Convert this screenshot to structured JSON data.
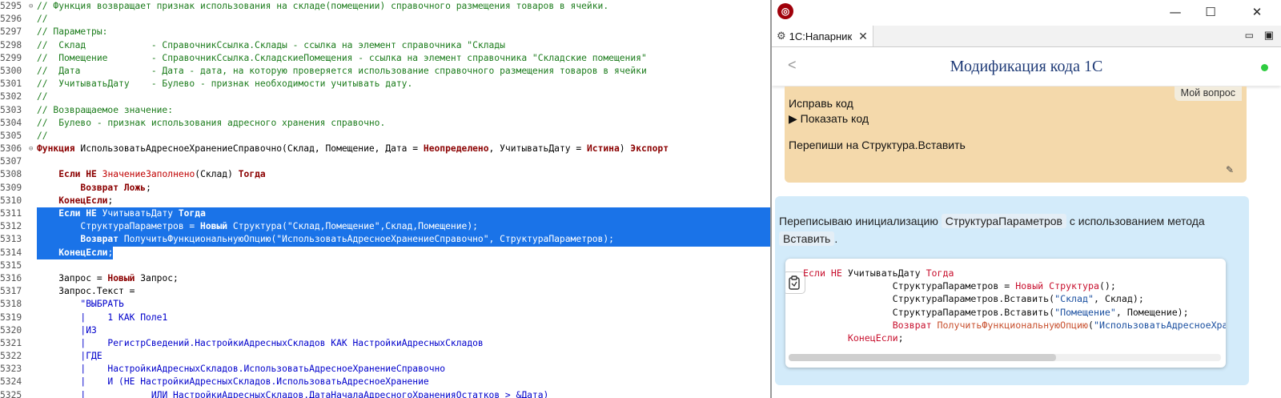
{
  "editor": {
    "lines": [
      {
        "n": "5295",
        "fold": "⊖",
        "segs": [
          [
            "t-cm",
            "// Функция возвращает признак использования на складе(помещении) справочного размещения товаров в ячейки."
          ]
        ]
      },
      {
        "n": "5296",
        "segs": [
          [
            "t-cm",
            "//"
          ]
        ]
      },
      {
        "n": "5297",
        "segs": [
          [
            "t-cm",
            "// Параметры:"
          ]
        ]
      },
      {
        "n": "5298",
        "segs": [
          [
            "t-cm",
            "//  Склад            - СправочникСсылка.Склады - ссылка на элемент справочника \"Склады"
          ]
        ]
      },
      {
        "n": "5299",
        "segs": [
          [
            "t-cm",
            "//  Помещение        - СправочникСсылка.СкладскиеПомещения - ссылка на элемент справочника \"Складские помещения\""
          ]
        ]
      },
      {
        "n": "5300",
        "segs": [
          [
            "t-cm",
            "//  Дата             - Дата - дата, на которую проверяется использование справочного размещения товаров в ячейки"
          ]
        ]
      },
      {
        "n": "5301",
        "segs": [
          [
            "t-cm",
            "//  УчитыватьДату    - Булево - признак необходимости учитывать дату."
          ]
        ]
      },
      {
        "n": "5302",
        "segs": [
          [
            "t-cm",
            "//"
          ]
        ]
      },
      {
        "n": "5303",
        "segs": [
          [
            "t-cm",
            "// Возвращаемое значение:"
          ]
        ]
      },
      {
        "n": "5304",
        "segs": [
          [
            "t-cm",
            "//  Булево - признак использования адресного хранения справочно."
          ]
        ]
      },
      {
        "n": "5305",
        "segs": [
          [
            "t-cm",
            "//"
          ]
        ]
      },
      {
        "n": "5306",
        "fold": "⊖",
        "segs": [
          [
            "t-kwb",
            "Функция"
          ],
          [
            "t-id",
            " ИспользоватьАдресноеХранениеСправочно(Склад, Помещение, Дата = "
          ],
          [
            "t-kwb",
            "Неопределено"
          ],
          [
            "t-id",
            ", УчитыватьДату = "
          ],
          [
            "t-kwb",
            "Истина"
          ],
          [
            "t-id",
            ") "
          ],
          [
            "t-kwb",
            "Экспорт"
          ]
        ]
      },
      {
        "n": "5307",
        "segs": []
      },
      {
        "n": "5308",
        "segs": [
          [
            "t-id",
            "    "
          ],
          [
            "t-kwb",
            "Если"
          ],
          [
            "t-id",
            " "
          ],
          [
            "t-kwb",
            "НЕ"
          ],
          [
            "t-id",
            " "
          ],
          [
            "t-kw",
            "ЗначениеЗаполнено"
          ],
          [
            "t-id",
            "(Склад) "
          ],
          [
            "t-kwb",
            "Тогда"
          ]
        ]
      },
      {
        "n": "5309",
        "segs": [
          [
            "t-id",
            "        "
          ],
          [
            "t-kwb",
            "Возврат"
          ],
          [
            "t-id",
            " "
          ],
          [
            "t-kwb",
            "Ложь"
          ],
          [
            "t-id",
            ";"
          ]
        ]
      },
      {
        "n": "5310",
        "segs": [
          [
            "t-id",
            "    "
          ],
          [
            "t-kwb",
            "КонецЕсли"
          ],
          [
            "t-id",
            ";"
          ]
        ]
      },
      {
        "n": "5311",
        "sel": "full",
        "segs": [
          [
            "t-id",
            "    "
          ],
          [
            "t-kwb",
            "Если НЕ"
          ],
          [
            "t-id",
            " УчитыватьДату "
          ],
          [
            "t-kwb",
            "Тогда"
          ]
        ]
      },
      {
        "n": "5312",
        "sel": "full",
        "segs": [
          [
            "t-id",
            "        СтруктураПараметров = "
          ],
          [
            "t-kwb",
            "Новый"
          ],
          [
            "t-id",
            " Структура(\"Склад,Помещение\",Склад,Помещение);"
          ]
        ]
      },
      {
        "n": "5313",
        "sel": "full",
        "segs": [
          [
            "t-id",
            "        "
          ],
          [
            "t-kwb",
            "Возврат"
          ],
          [
            "t-id",
            " ПолучитьФункциональнуюОпцию(\"ИспользоватьАдресноеХранениеСправочно\", СтруктураПараметров);"
          ]
        ]
      },
      {
        "n": "5314",
        "sel": "partial",
        "segs": [
          [
            "t-id",
            "    "
          ],
          [
            "t-kwb",
            "КонецЕсли"
          ],
          [
            "t-id",
            ";"
          ]
        ]
      },
      {
        "n": "5315",
        "segs": []
      },
      {
        "n": "5316",
        "segs": [
          [
            "t-id",
            "    Запрос = "
          ],
          [
            "t-kwb",
            "Новый"
          ],
          [
            "t-id",
            " Запрос;"
          ]
        ]
      },
      {
        "n": "5317",
        "segs": [
          [
            "t-id",
            "    Запрос.Текст ="
          ]
        ]
      },
      {
        "n": "5318",
        "segs": [
          [
            "t-id",
            "        "
          ],
          [
            "t-sq",
            "\"ВЫБРАТЬ"
          ]
        ]
      },
      {
        "n": "5319",
        "segs": [
          [
            "t-id",
            "        "
          ],
          [
            "t-sq",
            "|    1 КАК Поле1"
          ]
        ]
      },
      {
        "n": "5320",
        "segs": [
          [
            "t-id",
            "        "
          ],
          [
            "t-sq",
            "|ИЗ"
          ]
        ]
      },
      {
        "n": "5321",
        "segs": [
          [
            "t-id",
            "        "
          ],
          [
            "t-sq",
            "|    РегистрСведений.НастройкиАдресныхСкладов КАК НастройкиАдресныхСкладов"
          ]
        ]
      },
      {
        "n": "5322",
        "segs": [
          [
            "t-id",
            "        "
          ],
          [
            "t-sq",
            "|ГДЕ"
          ]
        ]
      },
      {
        "n": "5323",
        "segs": [
          [
            "t-id",
            "        "
          ],
          [
            "t-sq",
            "|    НастройкиАдресныхСкладов.ИспользоватьАдресноеХранениеСправочно"
          ]
        ]
      },
      {
        "n": "5324",
        "segs": [
          [
            "t-id",
            "        "
          ],
          [
            "t-sq",
            "|    И (НЕ НастройкиАдресныхСкладов.ИспользоватьАдресноеХранение"
          ]
        ]
      },
      {
        "n": "5325",
        "segs": [
          [
            "t-id",
            "        "
          ],
          [
            "t-sq",
            "|            ИЛИ НастройкиАдресныхСкладов.ДатаНачалаАдресногоХраненияОстатков > &Дата)"
          ]
        ]
      }
    ]
  },
  "window": {
    "app_icon": "1c-logo-icon",
    "minimize": "—",
    "maximize": "☐",
    "close": "✕"
  },
  "tab": {
    "label": "1С:Напарник",
    "icon": "assistant-icon",
    "close": "✕",
    "view_min": "▭",
    "view_max": "▣"
  },
  "panel": {
    "back": "<",
    "title": "Модификация кода 1С",
    "status_color": "#2ecc40"
  },
  "user_message": {
    "tag": "Мой вопрос",
    "line1": "Исправь код",
    "line2": "▶ Показать код",
    "line3": "Перепиши на Структура.Вставить"
  },
  "bot_message": {
    "text_before": "Переписываю инициализацию ",
    "chip1": "СтруктураПараметров",
    "text_mid": " с использованием метода ",
    "chip2": "Вставить",
    "text_after": ".",
    "code_lines": [
      [
        [
          "c-kw",
          "Если НЕ "
        ],
        [
          "c-id",
          "УчитыватьДату "
        ],
        [
          "c-kw",
          "Тогда"
        ]
      ],
      [
        [
          "c-id",
          "                СтруктураПараметров = "
        ],
        [
          "c-kw",
          "Новый Структура"
        ],
        [
          "c-id",
          "();"
        ]
      ],
      [
        [
          "c-id",
          "                СтруктураПараметров.Вставить("
        ],
        [
          "c-str",
          "\"Склад\""
        ],
        [
          "c-id",
          ", Склад);"
        ]
      ],
      [
        [
          "c-id",
          "                СтруктураПараметров.Вставить("
        ],
        [
          "c-str",
          "\"Помещение\""
        ],
        [
          "c-id",
          ", Помещение);"
        ]
      ],
      [
        [
          "c-id",
          "                "
        ],
        [
          "c-kw",
          "Возврат "
        ],
        [
          "c-fn",
          "ПолучитьФункциональнуюОпцию"
        ],
        [
          "c-id",
          "("
        ],
        [
          "c-str",
          "\"ИспользоватьАдресноеХранениеСправочно\""
        ],
        [
          "c-id",
          ", СтруктураПараметров);"
        ]
      ],
      [
        [
          "c-id",
          "        "
        ],
        [
          "c-kw",
          "КонецЕсли"
        ],
        [
          "c-id",
          ";"
        ]
      ]
    ]
  }
}
